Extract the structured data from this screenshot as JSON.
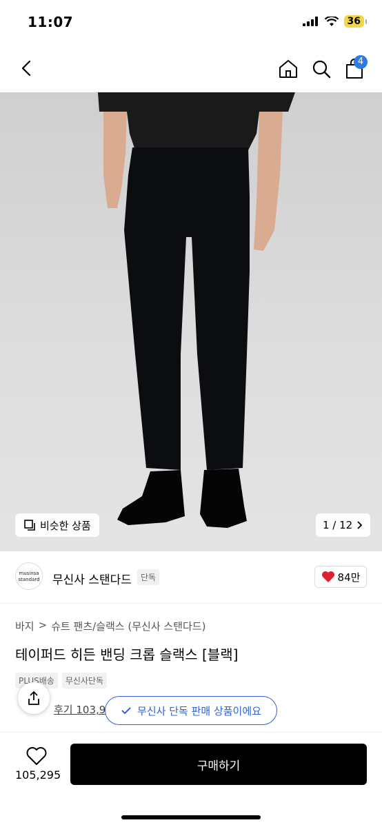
{
  "status": {
    "time": "11:07",
    "battery": "36"
  },
  "nav": {
    "bag_count": "4",
    "back_icon": "chevron-left-icon",
    "home_icon": "home-icon",
    "search_icon": "search-icon",
    "bag_icon": "shopping-bag-icon"
  },
  "hero": {
    "similar_label": "비슷한 상품",
    "pager": "1 / 12"
  },
  "brand": {
    "logo_text": "musinsa standard",
    "name": "무신사 스탠다드",
    "tag": "단독",
    "likes": "84만"
  },
  "product": {
    "breadcrumb": [
      "바지",
      "슈트 팬츠/슬랙스 (무신사 스탠다드)"
    ],
    "title": "테이퍼드 히든 밴딩 크롭 슬랙스 [블랙]",
    "tags": [
      "PLUS배송",
      "무신사단독"
    ],
    "review": "후기 103,9"
  },
  "toast": {
    "text": "무신사 단독 판매 상품이에요"
  },
  "bottom": {
    "wish_count": "105,295",
    "buy_label": "구매하기"
  },
  "colors": {
    "accent": "#2f63d8",
    "badge": "#2f7be5",
    "heart": "#e0202c",
    "battery": "#f2d64a"
  }
}
